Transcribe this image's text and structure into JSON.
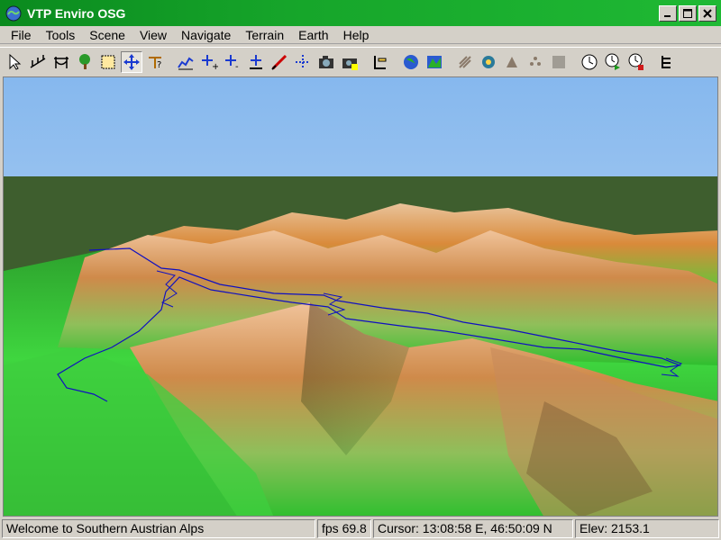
{
  "window": {
    "title": "VTP Enviro OSG"
  },
  "menu": [
    "File",
    "Tools",
    "Scene",
    "View",
    "Navigate",
    "Terrain",
    "Earth",
    "Help"
  ],
  "toolbar": [
    {
      "name": "select-arrow-icon"
    },
    {
      "name": "fence-tool-icon"
    },
    {
      "name": "route-tool-icon"
    },
    {
      "name": "tree-plant-icon"
    },
    {
      "name": "select-box-icon"
    },
    {
      "name": "move-tool-icon",
      "pressed": true
    },
    {
      "name": "instance-tool-icon"
    },
    {
      "sep": true
    },
    {
      "name": "profile-icon"
    },
    {
      "name": "nav-speed-up-icon"
    },
    {
      "name": "nav-slow-down-icon"
    },
    {
      "name": "nav-height-icon"
    },
    {
      "name": "nav-follow-icon"
    },
    {
      "name": "nav-grab-icon"
    },
    {
      "name": "camera-icon"
    },
    {
      "name": "camera-nav-icon"
    },
    {
      "sep": true
    },
    {
      "name": "layers-icon"
    },
    {
      "sep": true
    },
    {
      "name": "globe-icon"
    },
    {
      "name": "terrain-switch-icon"
    },
    {
      "sep": true
    },
    {
      "name": "sun-rays-icon"
    },
    {
      "name": "space-nav-icon"
    },
    {
      "name": "pyramid-icon"
    },
    {
      "name": "dots-icon"
    },
    {
      "name": "blank-tool-icon"
    },
    {
      "sep": true
    },
    {
      "name": "clock-icon"
    },
    {
      "name": "clock-play-icon"
    },
    {
      "name": "clock-stop-icon"
    },
    {
      "sep": true
    },
    {
      "name": "scene-graph-icon"
    }
  ],
  "status": {
    "message": "Welcome to Southern Austrian Alps",
    "fps": "fps 69.8",
    "cursor": "Cursor: 13:08:58 E,  46:50:09 N",
    "elev": "Elev: 2153.1"
  },
  "colors": {
    "title_bar": "#16a52a",
    "sky": "#9ec6f0",
    "terrain_low": "#2fcf2f",
    "terrain_high": "#d9914a",
    "track": "#1010c0"
  }
}
